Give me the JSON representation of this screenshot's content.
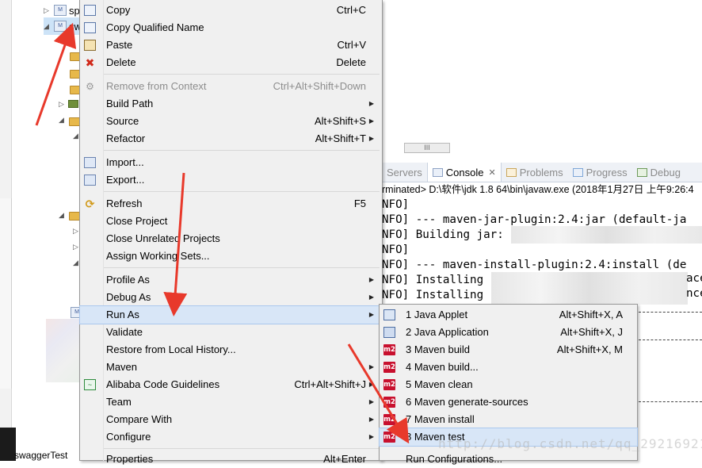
{
  "explorer": {
    "rows": [
      {
        "text": "sp"
      },
      {
        "text": "sw"
      }
    ],
    "bottom_tab": "swaggerTest"
  },
  "console_view": {
    "tabs": [
      {
        "label": "Servers",
        "icon": "servers-icon"
      },
      {
        "label": "Console",
        "icon": "console-icon",
        "active": true
      },
      {
        "label": "Problems",
        "icon": "problems-icon"
      },
      {
        "label": "Progress",
        "icon": "progress-icon"
      },
      {
        "label": "Debug",
        "icon": "debug-icon"
      }
    ],
    "status": "rminated> D:\\软件\\jdk 1.8 64\\bin\\javaw.exe (2018年1月27日 上午9:26:4",
    "scrollbar_glyph": "III",
    "lines": [
      "NFO]",
      "NFO] --- maven-jar-plugin:2.4:jar (default-ja",
      "NFO] Building jar:",
      "NFO]",
      "NFO] --- maven-install-plugin:2.4:install (de",
      "NFO] Installing",
      "NFO] Installing",
      "",
      "",
      "",
      "",
      "                                   7+08:00",
      "",
      ""
    ],
    "line_tails": [
      "",
      "",
      "",
      "",
      "",
      "ace",
      "nce",
      "",
      "",
      "",
      "",
      "",
      "",
      ""
    ]
  },
  "context_menu": {
    "items": [
      {
        "label": "Copy",
        "accel": "Ctrl+C",
        "icon": "copy-icon"
      },
      {
        "label": "Copy Qualified Name",
        "accel": "",
        "icon": "copy-qualified-icon"
      },
      {
        "label": "Paste",
        "accel": "Ctrl+V",
        "icon": "paste-icon"
      },
      {
        "label": "Delete",
        "accel": "Delete",
        "icon": "delete-icon"
      },
      {
        "label": "Remove from Context",
        "accel": "Ctrl+Alt+Shift+Down",
        "icon": "remove-context-icon",
        "disabled": true
      },
      {
        "label": "Build Path",
        "accel": "",
        "submenu": true
      },
      {
        "label": "Source",
        "accel": "Alt+Shift+S",
        "submenu": true
      },
      {
        "label": "Refactor",
        "accel": "Alt+Shift+T",
        "submenu": true
      },
      {
        "label": "Import...",
        "accel": "",
        "icon": "import-icon"
      },
      {
        "label": "Export...",
        "accel": "",
        "icon": "export-icon"
      },
      {
        "label": "Refresh",
        "accel": "F5",
        "icon": "refresh-icon"
      },
      {
        "label": "Close Project",
        "accel": ""
      },
      {
        "label": "Close Unrelated Projects",
        "accel": ""
      },
      {
        "label": "Assign Working Sets...",
        "accel": ""
      },
      {
        "label": "Profile As",
        "accel": "",
        "submenu": true
      },
      {
        "label": "Debug As",
        "accel": "",
        "submenu": true
      },
      {
        "label": "Run As",
        "accel": "",
        "submenu": true,
        "highlighted": true
      },
      {
        "label": "Validate",
        "accel": ""
      },
      {
        "label": "Restore from Local History...",
        "accel": ""
      },
      {
        "label": "Maven",
        "accel": "",
        "submenu": true
      },
      {
        "label": "Alibaba Code Guidelines",
        "accel": "Ctrl+Alt+Shift+J",
        "icon": "alibaba-icon"
      },
      {
        "label": "Team",
        "accel": "",
        "submenu": true
      },
      {
        "label": "Compare With",
        "accel": "",
        "submenu": true
      },
      {
        "label": "Configure",
        "accel": "",
        "submenu": true
      },
      {
        "label": "Properties",
        "accel": "Alt+Enter"
      }
    ],
    "submenu_glyph": "▶"
  },
  "run_as_submenu": {
    "items": [
      {
        "label": "1 Java Applet",
        "accel": "Alt+Shift+X, A",
        "icon": "java-applet-icon"
      },
      {
        "label": "2 Java Application",
        "accel": "Alt+Shift+X, J",
        "icon": "java-application-icon"
      },
      {
        "label": "3 Maven build",
        "accel": "Alt+Shift+X, M",
        "icon": "m2-icon",
        "badge": "m2"
      },
      {
        "label": "4 Maven build...",
        "accel": "",
        "icon": "m2-icon",
        "badge": "m2"
      },
      {
        "label": "5 Maven clean",
        "accel": "",
        "icon": "m2-icon",
        "badge": "m2"
      },
      {
        "label": "6 Maven generate-sources",
        "accel": "",
        "icon": "m2-icon",
        "badge": "m2"
      },
      {
        "label": "7 Maven install",
        "accel": "",
        "icon": "m2-icon",
        "badge": "m2"
      },
      {
        "label": "8 Maven test",
        "accel": "",
        "icon": "m2-icon",
        "badge": "m2",
        "highlighted": true
      },
      {
        "label": "Run Configurations...",
        "accel": ""
      }
    ]
  },
  "watermark": "http://blog.csdn.net/qq_29216921",
  "colors": {
    "menu_bg": "#f0f0f0",
    "menu_highlight": "#d8e6f7",
    "annotation_arrow": "#e8392b",
    "m2_badge": "#c8102e"
  }
}
